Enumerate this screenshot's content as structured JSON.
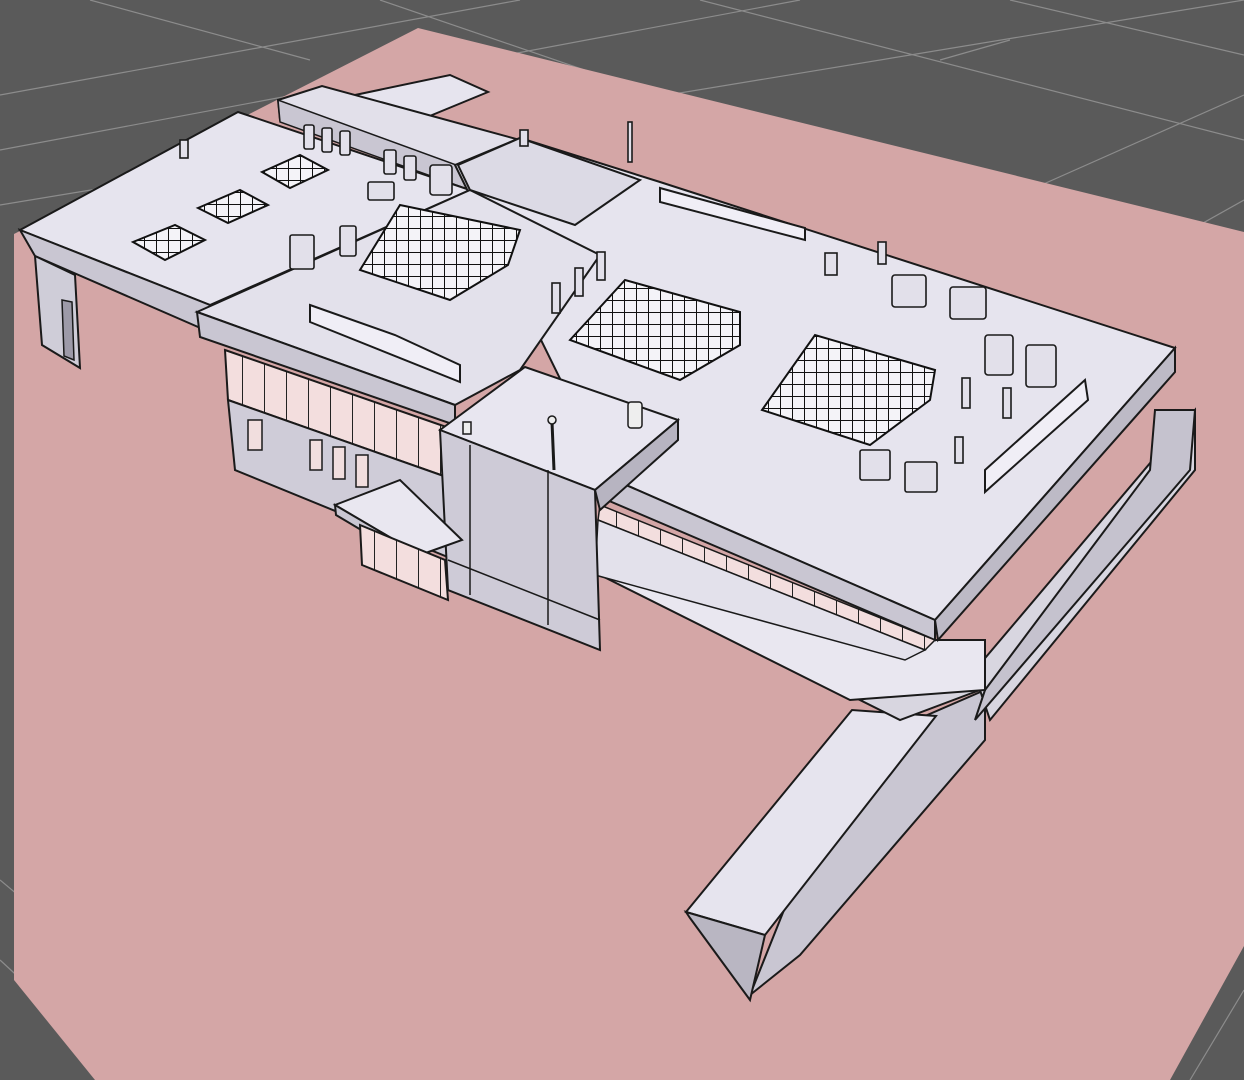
{
  "viewport": {
    "label": "",
    "background_color": "#5a5a5a",
    "grid_line_color": "#8c8c8c",
    "ground_color": "#d4a6a6",
    "model_face_color": "#e6e4ee",
    "model_side_color": "#c9c6d2",
    "edge_color": "#1a1a1a"
  },
  "model": {
    "signs": [
      "",
      "",
      ""
    ],
    "skylight_count": 6,
    "objects": [
      "west-roof",
      "east-roof",
      "central-core",
      "entrance-canopy",
      "ramp",
      "north-annex",
      "rooftop-units",
      "skylights",
      "signage"
    ]
  }
}
